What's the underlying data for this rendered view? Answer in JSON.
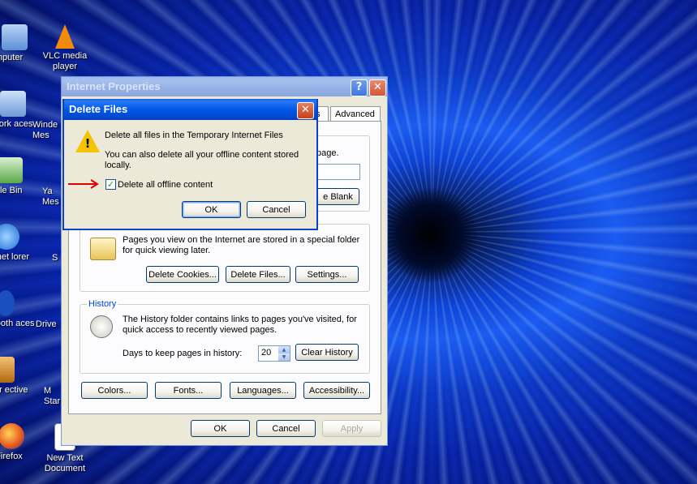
{
  "desktop": {
    "icons": [
      {
        "label": "mputer"
      },
      {
        "label": "VLC media player"
      },
      {
        "label": "etwork aces"
      },
      {
        "label": "Winde Mes"
      },
      {
        "label": "cle Bin"
      },
      {
        "label": "Ya Mes"
      },
      {
        "label": "ernet lorer"
      },
      {
        "label": "S"
      },
      {
        "label": "uetooth aces"
      },
      {
        "label": "Drive"
      },
      {
        "label": "ver ective"
      },
      {
        "label": "M Star"
      },
      {
        "label": "Firefox"
      },
      {
        "label": "New Text Document"
      }
    ]
  },
  "internet_properties": {
    "title": "Internet Properties",
    "help_btn": "?",
    "close_btn": "✕",
    "tabs": [
      "ms",
      "Advanced"
    ],
    "home_page_fragment": "page.",
    "use_blank_fragment": "e Blank",
    "temp_files_text": "Pages you view on the Internet are stored in a special folder for quick viewing later.",
    "delete_cookies": "Delete Cookies...",
    "delete_files": "Delete Files...",
    "settings": "Settings...",
    "history_label": "History",
    "history_text": "The History folder contains links to pages you've visited, for quick access to recently viewed pages.",
    "days_label": "Days to keep pages in history:",
    "days_value": "20",
    "clear_history": "Clear History",
    "colors": "Colors...",
    "fonts": "Fonts...",
    "languages": "Languages...",
    "accessibility": "Accessibility...",
    "ok": "OK",
    "cancel": "Cancel",
    "apply": "Apply"
  },
  "delete_files_dialog": {
    "title": "Delete Files",
    "close_btn": "✕",
    "line1": "Delete all files in the Temporary Internet Files",
    "line2": "You can also delete all your offline content stored locally.",
    "checkbox_label": "Delete all offline content",
    "checkbox_checked": true,
    "ok": "OK",
    "cancel": "Cancel"
  }
}
